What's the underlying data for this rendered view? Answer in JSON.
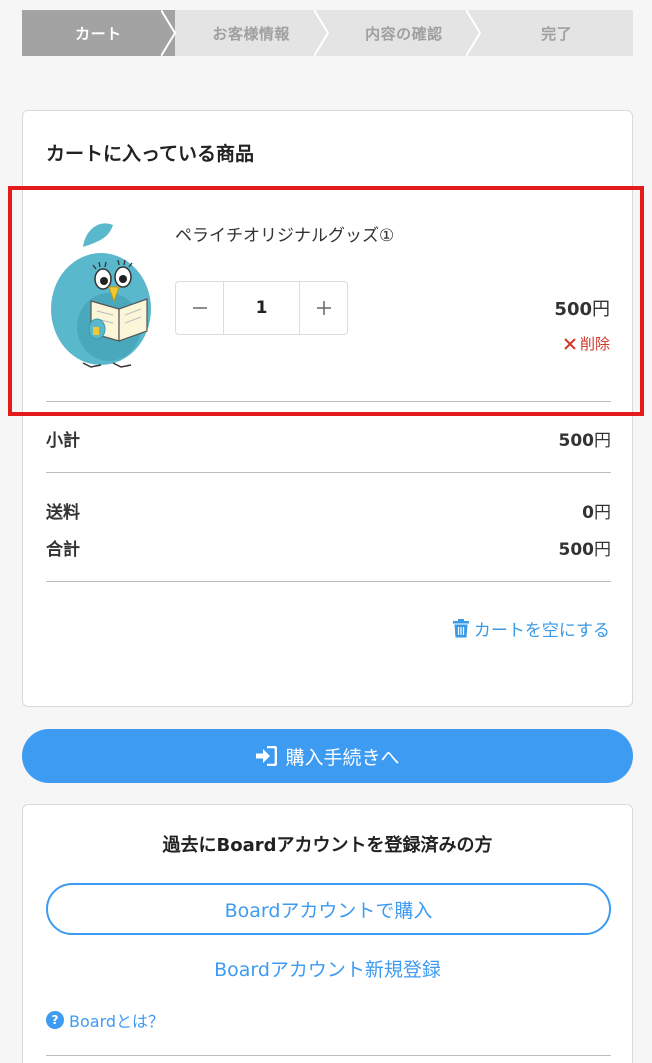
{
  "steps": [
    {
      "label": "カート",
      "active": true
    },
    {
      "label": "お客様情報",
      "active": false
    },
    {
      "label": "内容の確認",
      "active": false
    },
    {
      "label": "完了",
      "active": false
    }
  ],
  "cart": {
    "title": "カートに入っている商品",
    "item": {
      "name": "ペライチオリジナルグッズ①",
      "quantity": "1",
      "price": "500",
      "currency": "円",
      "delete_label": "削除",
      "image_icon": "bird-mascot-reading-icon"
    },
    "subtotal": {
      "label": "小計",
      "value": "500",
      "currency": "円"
    },
    "shipping": {
      "label": "送料",
      "value": "0",
      "currency": "円"
    },
    "total": {
      "label": "合計",
      "value": "500",
      "currency": "円"
    },
    "empty_label": "カートを空にする"
  },
  "checkout": {
    "label": "購入手続きへ"
  },
  "board": {
    "title": "過去にBoardアカウントを登録済みの方",
    "buy_label": "Boardアカウントで購入",
    "register_label": "Boardアカウント新規登録",
    "what_label": "Boardとは？"
  },
  "colors": {
    "accent": "#3d9bf2",
    "delete": "#d0392b",
    "highlight": "#e31b1b",
    "step_active": "#a3a3a3"
  }
}
